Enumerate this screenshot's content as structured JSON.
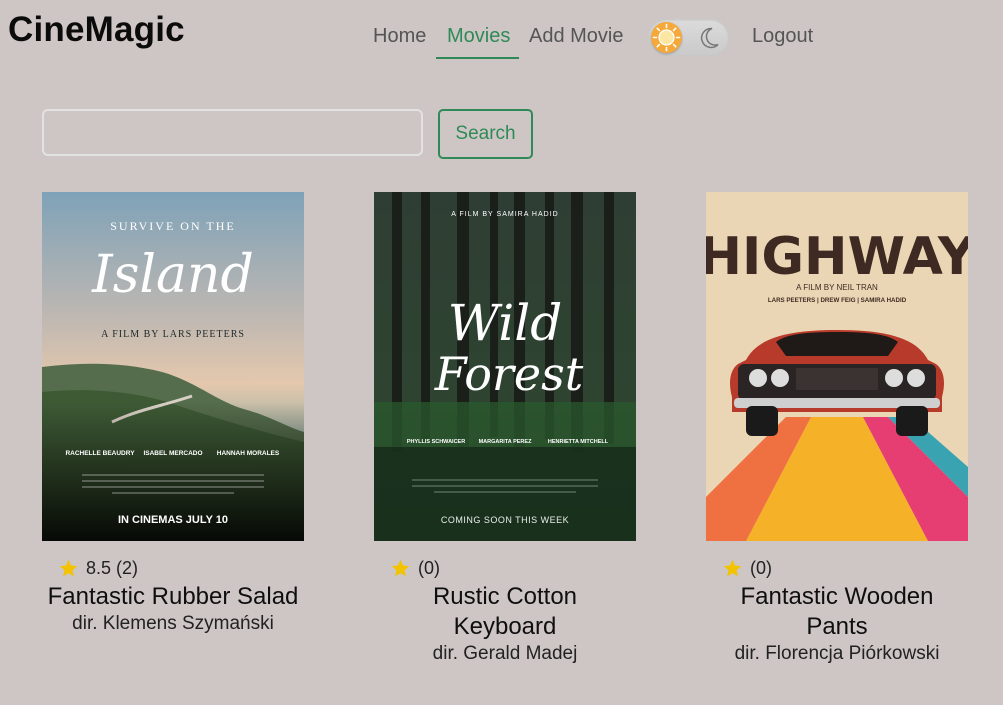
{
  "brand": "CineMagic",
  "nav": {
    "items": [
      {
        "label": "Home"
      },
      {
        "label": "Movies"
      },
      {
        "label": "Add Movie"
      },
      {
        "label": "Logout"
      }
    ]
  },
  "search": {
    "value": "",
    "placeholder": "",
    "button_label": "Search"
  },
  "colors": {
    "background": "#cec6c5",
    "accent": "#2f8a57",
    "star": "#f3c300"
  },
  "movies": [
    {
      "poster": {
        "top_line": "SURVIVE ON THE",
        "title": "Island",
        "credit": "A FILM BY LARS PEETERS",
        "cast": [
          "RACHELLE BEAUDRY",
          "ISABEL MERCADO",
          "HANNAH MORALES"
        ],
        "bottom": "IN CINEMAS JULY 10"
      },
      "rating_text": "8.5 (2)",
      "title": "Fantastic Rubber Salad",
      "director": "dir. Klemens Szymański"
    },
    {
      "poster": {
        "top_line": "A FILM BY SAMIRA HADID",
        "title_line1": "Wild",
        "title_line2": "Forest",
        "cast": [
          "PHYLLIS SCHWAICER",
          "MARGARITA PEREZ",
          "HENRIETTA MITCHELL"
        ],
        "bottom": "COMING SOON THIS WEEK"
      },
      "rating_text": "(0)",
      "title_line1": "Rustic Cotton",
      "title_line2": "Keyboard",
      "director": "dir. Gerald Madej"
    },
    {
      "poster": {
        "title": "HIGHWAY",
        "credit": "A FILM BY NEIL TRAN",
        "cast": "LARS PEETERS | DREW FEIG | SAMIRA HADID"
      },
      "rating_text": "(0)",
      "title_line1": "Fantastic Wooden",
      "title_line2": "Pants",
      "director": "dir. Florencja Piórkowski"
    }
  ]
}
